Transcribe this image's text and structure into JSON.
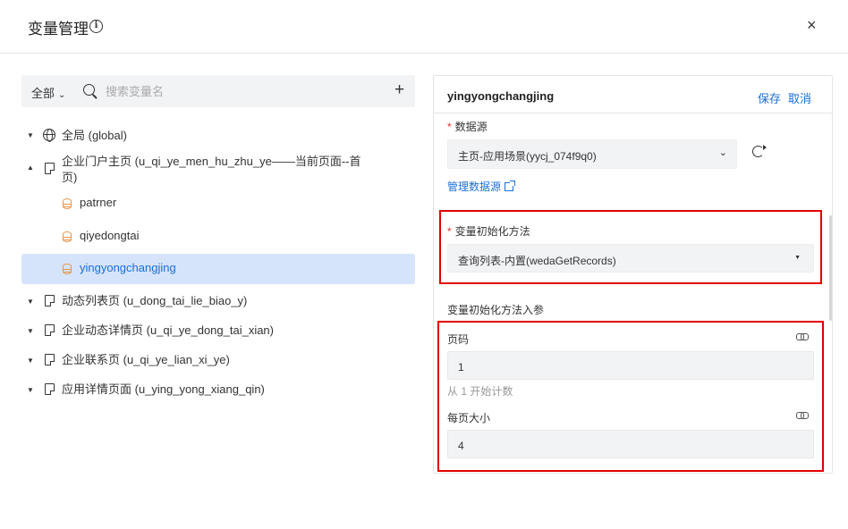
{
  "dialog": {
    "title": "变量管理",
    "info_icon": "info-icon",
    "close": "×"
  },
  "left": {
    "scope": "全部",
    "search_placeholder": "搜索变量名",
    "add": "+",
    "tree": {
      "global": "全局 (global)",
      "home_page": "企业门户主页 (u_qi_ye_men_hu_zhu_ye——当前页面--首",
      "home_page_cont": "页)",
      "var1": "patrner",
      "var2": "qiyedongtai",
      "var3": "yingyongchangjing",
      "page2": "动态列表页 (u_dong_tai_lie_biao_y)",
      "page3": "企业动态详情页 (u_qi_ye_dong_tai_xian)",
      "page4": "企业联系页 (u_qi_ye_lian_xi_ye)",
      "page5": "应用详情页面 (u_ying_yong_xiang_qin)"
    }
  },
  "right": {
    "var_name": "yingyongchangjing",
    "save": "保存",
    "cancel": "取消",
    "datasource_label": "数据源",
    "datasource_value": "主页-应用场景(yycj_074f9q0)",
    "manage_datasource": "管理数据源",
    "init_method_label": "变量初始化方法",
    "init_method_value": "查询列表-内置(wedaGetRecords)",
    "params_label": "变量初始化方法入参",
    "page_label": "页码",
    "page_value": "1",
    "page_hint": "从 1 开始计数",
    "page_size_label": "每页大小",
    "page_size_value": "4",
    "required_mark": "*"
  }
}
